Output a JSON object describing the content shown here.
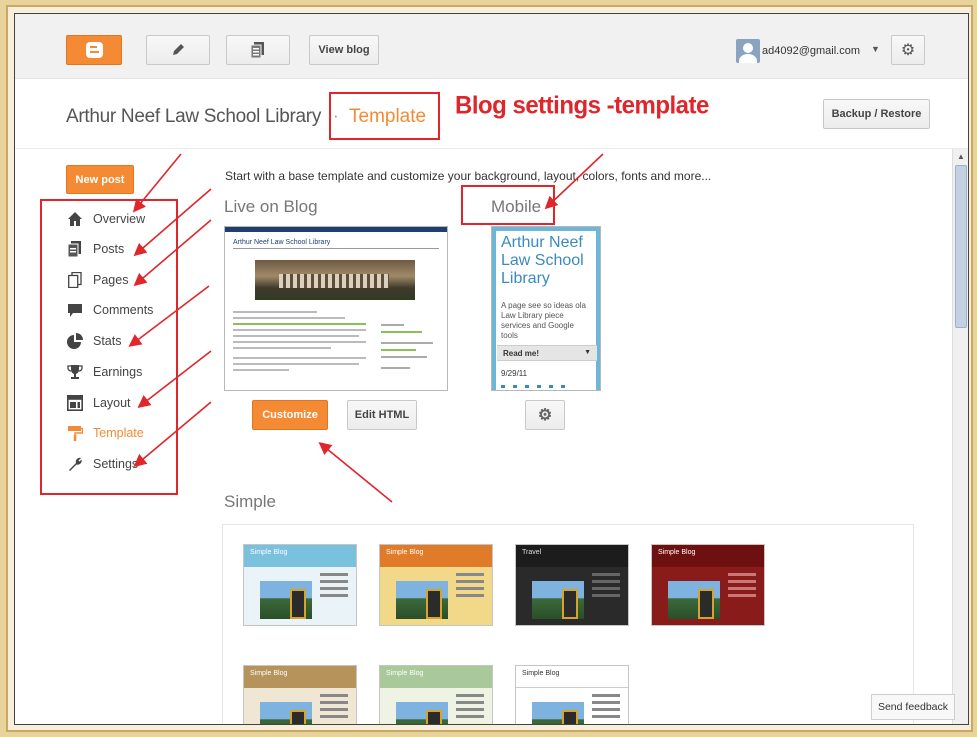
{
  "topbar": {
    "view_blog": "View blog",
    "email": "ad4092@gmail.com",
    "caret": "▼"
  },
  "header": {
    "blog_title": "Arthur Neef Law School Library",
    "separator": "·",
    "current_section": "Template",
    "backup_label": "Backup / Restore"
  },
  "annotation": {
    "title": "Blog settings -template"
  },
  "sidebar": {
    "new_post": "New post",
    "items": [
      {
        "label": "Overview",
        "icon": "house-icon"
      },
      {
        "label": "Posts",
        "icon": "posts-icon"
      },
      {
        "label": "Pages",
        "icon": "pages-icon"
      },
      {
        "label": "Comments",
        "icon": "comment-icon"
      },
      {
        "label": "Stats",
        "icon": "pie-chart-icon"
      },
      {
        "label": "Earnings",
        "icon": "trophy-icon"
      },
      {
        "label": "Layout",
        "icon": "layout-icon"
      },
      {
        "label": "Template",
        "icon": "paint-roller-icon"
      },
      {
        "label": "Settings",
        "icon": "wrench-icon"
      }
    ]
  },
  "main": {
    "intro": "Start with a base template and customize your background, layout, colors, fonts and more...",
    "live_heading": "Live on Blog",
    "mobile_heading": "Mobile",
    "live_preview_title": "Arthur Neef Law School Library",
    "mobile_preview": {
      "title": "Arthur Neef Law School Library",
      "description": "A page see so ideas ola Law Library piece services and Google tools",
      "read_more": "Read me!",
      "date": "9/29/11"
    },
    "customize": "Customize",
    "edit_html": "Edit HTML",
    "simple_heading": "Simple",
    "simple_templates": [
      {
        "name": "Simple Blog",
        "theme": "blue"
      },
      {
        "name": "Simple Blog",
        "theme": "orange"
      },
      {
        "name": "Travel",
        "theme": "dark"
      },
      {
        "name": "Simple Blog",
        "theme": "red"
      },
      {
        "name": "Simple Blog",
        "theme": "tan"
      },
      {
        "name": "Simple Blog",
        "theme": "green"
      },
      {
        "name": "Simple Blog",
        "theme": "white"
      }
    ]
  },
  "feedback": "Send feedback",
  "colors": {
    "accent": "#f58a34",
    "annotation": "#e0262a"
  }
}
